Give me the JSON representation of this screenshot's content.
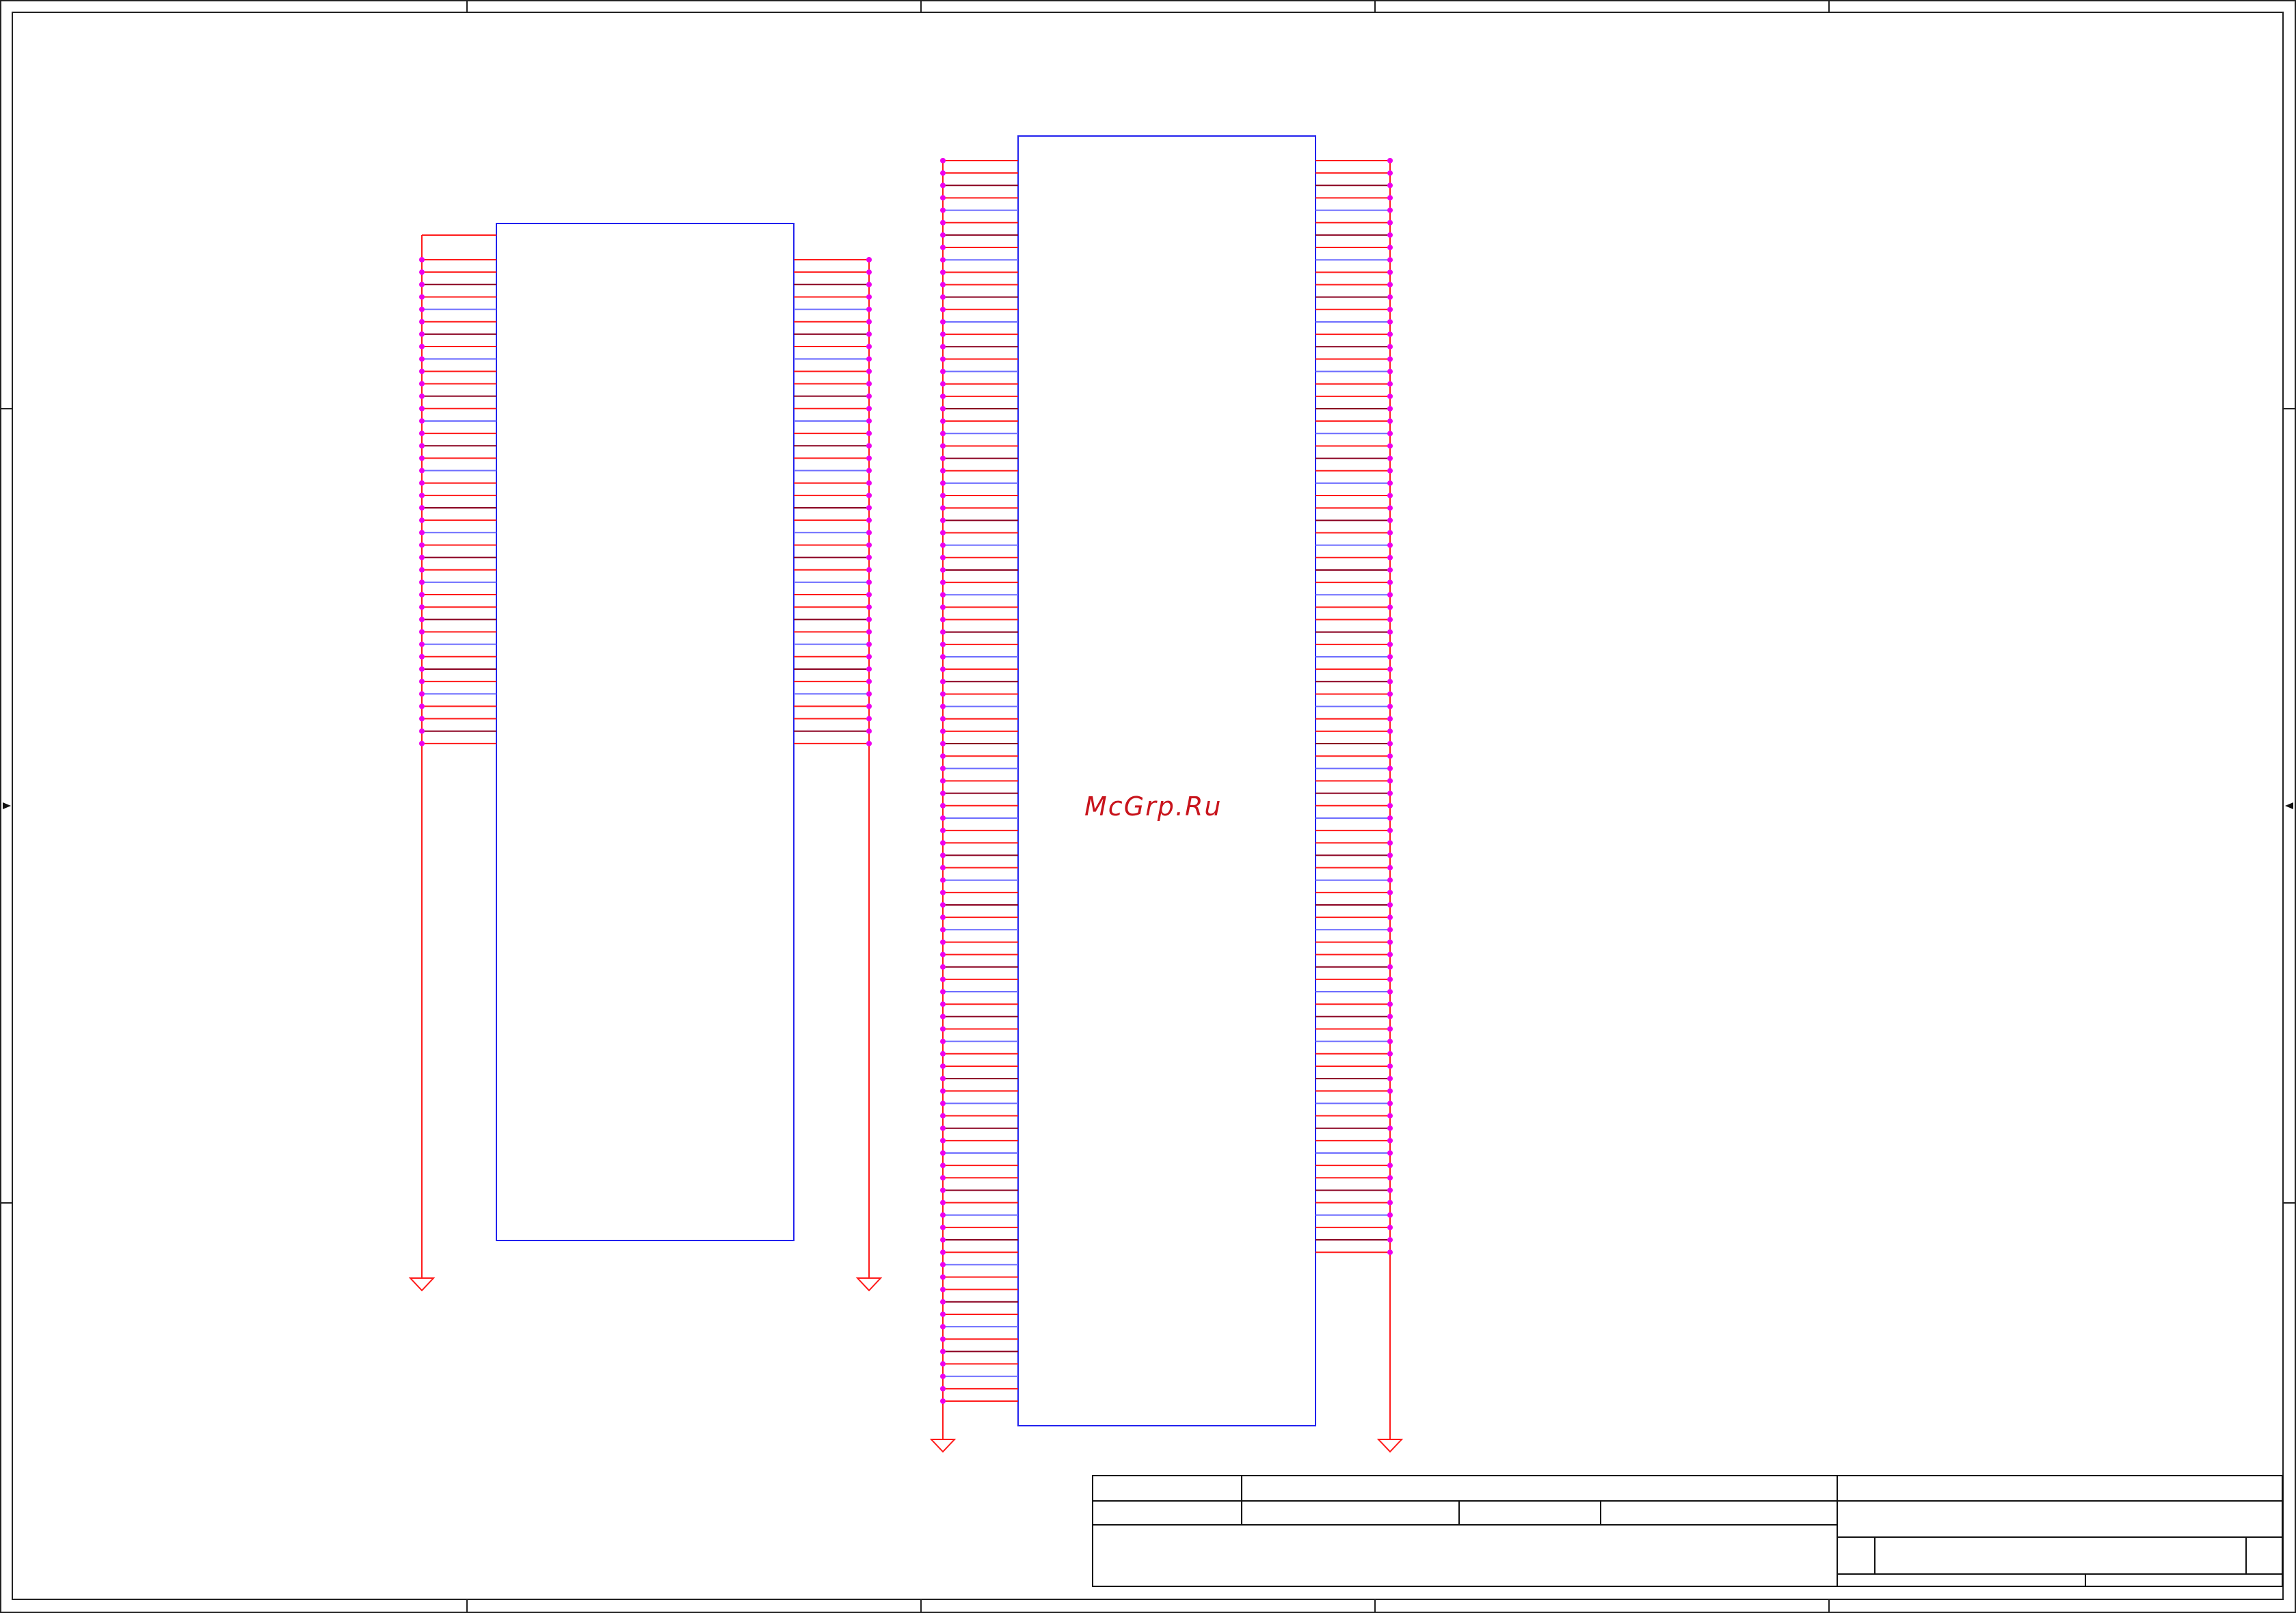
{
  "watermark": {
    "text": "McGrp.Ru"
  },
  "colors": {
    "frame": "#222222",
    "component_body": "#2222ee",
    "wire_red": "#ff1a1a",
    "wire_dark": "#8a0020",
    "wire_blue": "#6c6cff",
    "junction": "#ee00ee",
    "ground_symbol": "#ff1a1a",
    "watermark": "#c8141c"
  },
  "icons": {
    "ground": "ground-icon",
    "junction": "junction-dot",
    "edge_marker": "arrow-marker-icon"
  },
  "components": [
    {
      "name": "connector-left",
      "left_pins": 41,
      "right_pins": 40,
      "ground_symbols": 2
    },
    {
      "name": "connector-right",
      "left_pins": 101,
      "right_pins": 89,
      "ground_symbols": 2
    }
  ],
  "title_block": {
    "visible_text": []
  }
}
